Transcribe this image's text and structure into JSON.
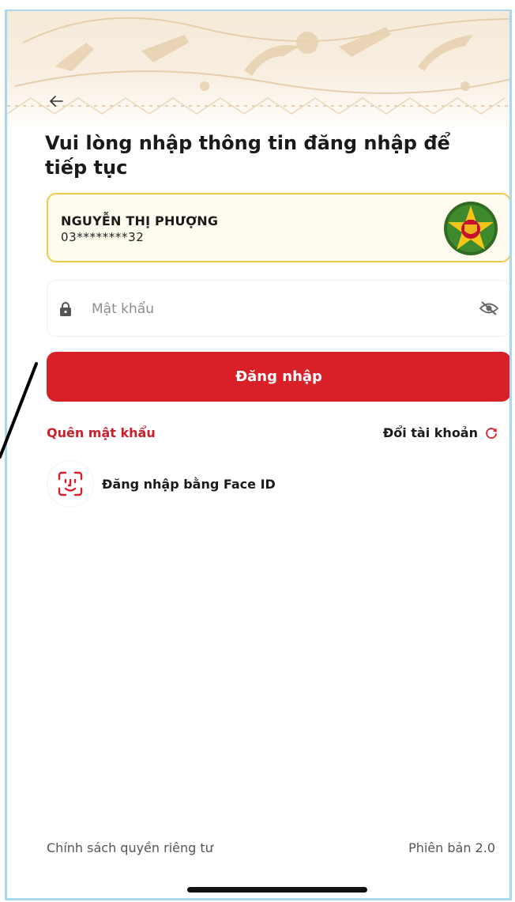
{
  "header": {
    "back_icon": "arrow-left-icon",
    "title": "Vui lòng nhập thông tin đăng nhập để tiếp tục"
  },
  "account": {
    "name": "NGUYỄN THỊ PHƯỢNG",
    "phone_masked": "03********32",
    "badge_icon": "police-emblem-icon"
  },
  "password": {
    "placeholder": "Mật khẩu",
    "value": "",
    "lock_icon": "lock-icon",
    "toggle_icon": "eye-off-icon"
  },
  "actions": {
    "login_label": "Đăng nhập",
    "forgot_password": "Quên mật khẩu",
    "switch_account": "Đổi tài khoản",
    "switch_icon": "refresh-icon",
    "face_id_label": "Đăng nhập bằng Face ID",
    "face_id_icon": "face-id-icon"
  },
  "footer": {
    "privacy": "Chính sách quyền riêng tư",
    "version": "Phiên bản 2.0"
  },
  "colors": {
    "primary_red": "#d91f27",
    "link_red": "#cc1f2a",
    "card_border_gold": "#f0c94a",
    "frame_border": "#a9d7ee"
  }
}
